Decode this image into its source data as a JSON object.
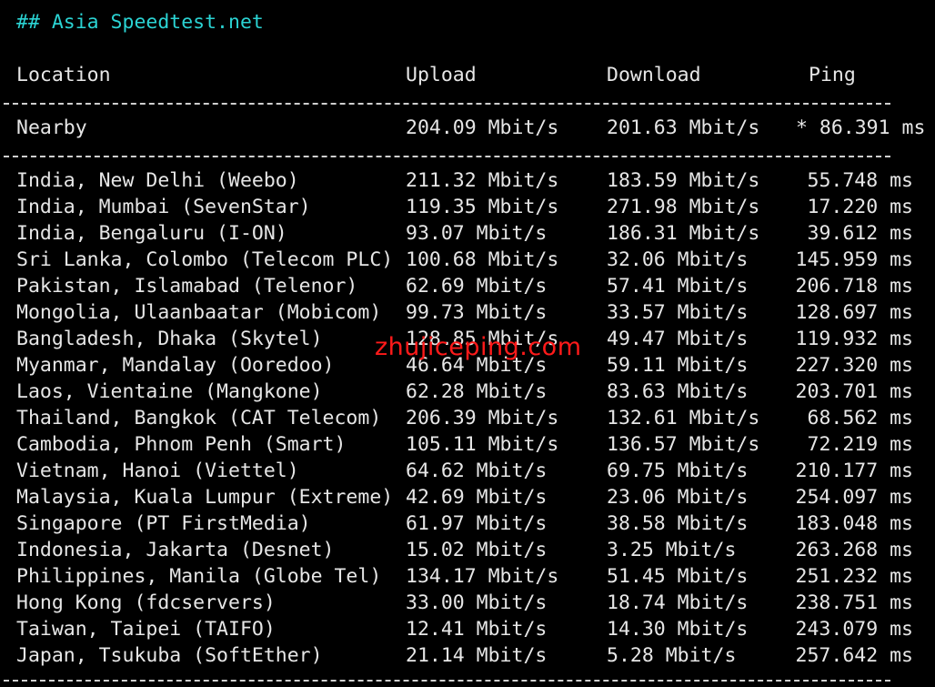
{
  "heading": "## Asia Speedtest.net",
  "columns": {
    "location": "Location",
    "upload": "Upload",
    "download": "Download",
    "ping": "Ping"
  },
  "nearby": {
    "location": "Nearby",
    "upload": "204.09 Mbit/s",
    "download": "201.63 Mbit/s",
    "ping": "* 86.391 ms"
  },
  "rows": [
    {
      "location": "India, New Delhi (Weebo)",
      "upload": "211.32 Mbit/s",
      "download": "183.59 Mbit/s",
      "ping": "55.748 ms"
    },
    {
      "location": "India, Mumbai (SevenStar)",
      "upload": "119.35 Mbit/s",
      "download": "271.98 Mbit/s",
      "ping": "17.220 ms"
    },
    {
      "location": "India, Bengaluru (I-ON)",
      "upload": "93.07 Mbit/s",
      "download": "186.31 Mbit/s",
      "ping": "39.612 ms"
    },
    {
      "location": "Sri Lanka, Colombo (Telecom PLC)",
      "upload": "100.68 Mbit/s",
      "download": "32.06 Mbit/s",
      "ping": "145.959 ms"
    },
    {
      "location": "Pakistan, Islamabad (Telenor)",
      "upload": "62.69 Mbit/s",
      "download": "57.41 Mbit/s",
      "ping": "206.718 ms"
    },
    {
      "location": "Mongolia, Ulaanbaatar (Mobicom)",
      "upload": "99.73 Mbit/s",
      "download": "33.57 Mbit/s",
      "ping": "128.697 ms"
    },
    {
      "location": "Bangladesh, Dhaka (Skytel)",
      "upload": "128.85 Mbit/s",
      "download": "49.47 Mbit/s",
      "ping": "119.932 ms"
    },
    {
      "location": "Myanmar, Mandalay (Ooredoo)",
      "upload": "46.64 Mbit/s",
      "download": "59.11 Mbit/s",
      "ping": "227.320 ms"
    },
    {
      "location": "Laos, Vientaine (Mangkone)",
      "upload": "62.28 Mbit/s",
      "download": "83.63 Mbit/s",
      "ping": "203.701 ms"
    },
    {
      "location": "Thailand, Bangkok (CAT Telecom)",
      "upload": "206.39 Mbit/s",
      "download": "132.61 Mbit/s",
      "ping": "68.562 ms"
    },
    {
      "location": "Cambodia, Phnom Penh (Smart)",
      "upload": "105.11 Mbit/s",
      "download": "136.57 Mbit/s",
      "ping": "72.219 ms"
    },
    {
      "location": "Vietnam, Hanoi (Viettel)",
      "upload": "64.62 Mbit/s",
      "download": "69.75 Mbit/s",
      "ping": "210.177 ms"
    },
    {
      "location": "Malaysia, Kuala Lumpur (Extreme)",
      "upload": "42.69 Mbit/s",
      "download": "23.06 Mbit/s",
      "ping": "254.097 ms"
    },
    {
      "location": "Singapore (PT FirstMedia)",
      "upload": "61.97 Mbit/s",
      "download": "38.58 Mbit/s",
      "ping": "183.048 ms"
    },
    {
      "location": "Indonesia, Jakarta (Desnet)",
      "upload": "15.02 Mbit/s",
      "download": "3.25 Mbit/s",
      "ping": "263.268 ms"
    },
    {
      "location": "Philippines, Manila (Globe Tel)",
      "upload": "134.17 Mbit/s",
      "download": "51.45 Mbit/s",
      "ping": "251.232 ms"
    },
    {
      "location": "Hong Kong (fdcservers)",
      "upload": "33.00 Mbit/s",
      "download": "18.74 Mbit/s",
      "ping": "238.751 ms"
    },
    {
      "location": "Taiwan, Taipei (TAIFO)",
      "upload": "12.41 Mbit/s",
      "download": "14.30 Mbit/s",
      "ping": "243.079 ms"
    },
    {
      "location": "Japan, Tsukuba (SoftEther)",
      "upload": "21.14 Mbit/s",
      "download": "5.28 Mbit/s",
      "ping": "257.642 ms"
    }
  ],
  "watermark": "zhujiceping.com",
  "colors": {
    "background": "#000000",
    "text": "#e6e6e6",
    "heading": "#2bd3d3",
    "watermark": "#ff1a1a"
  }
}
